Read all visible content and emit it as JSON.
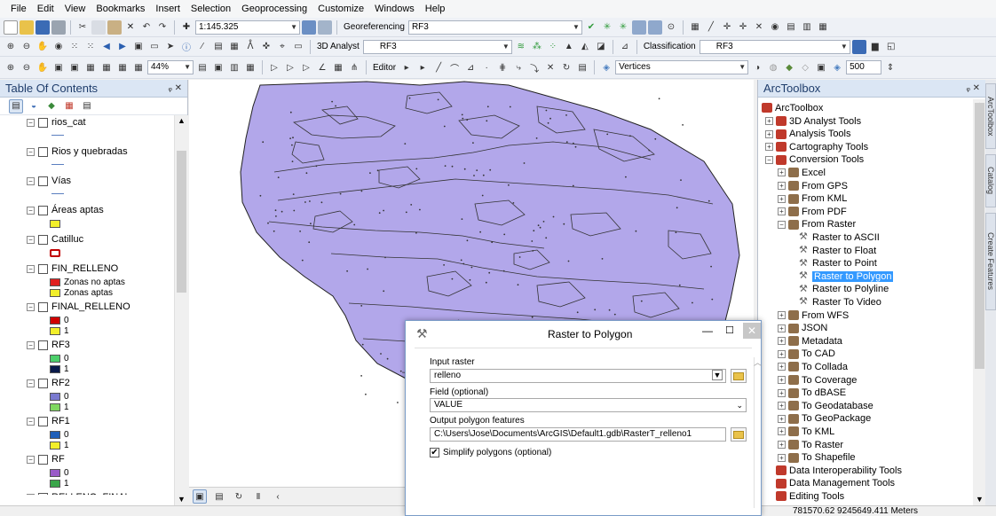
{
  "menu": [
    "File",
    "Edit",
    "View",
    "Bookmarks",
    "Insert",
    "Selection",
    "Geoprocessing",
    "Customize",
    "Windows",
    "Help"
  ],
  "toolbar": {
    "scale": "1:145.325",
    "georef_label": "Georeferencing",
    "georef_layer": "RF3",
    "analyst_label": "3D Analyst",
    "analyst_layer": "RF3",
    "classification_label": "Classification",
    "classification_layer": "RF3",
    "zoom_pct": "44%",
    "editor_label": "Editor",
    "vertices_label": "Vertices",
    "vertex_size": "500"
  },
  "toc": {
    "title": "Table Of Contents",
    "layers": [
      {
        "name": "rios_cat",
        "symbol": "line"
      },
      {
        "name": "Rios y quebradas",
        "symbol": "line"
      },
      {
        "name": "Vías",
        "symbol": "line"
      },
      {
        "name": "Áreas aptas",
        "symbol": "fill",
        "color": "#f2ef2a"
      },
      {
        "name": "Catilluc",
        "symbol": "outline",
        "color": "#c00000"
      },
      {
        "name": "FIN_RELLENO",
        "classes": [
          {
            "label": "Zonas no aptas",
            "color": "#e02020"
          },
          {
            "label": "Zonas aptas",
            "color": "#f2ef2a"
          }
        ]
      },
      {
        "name": "FINAL_RELLENO",
        "classes": [
          {
            "label": "0",
            "color": "#d00000"
          },
          {
            "label": "1",
            "color": "#f2ef2a"
          }
        ]
      },
      {
        "name": "RF3",
        "classes": [
          {
            "label": "0",
            "color": "#4ccf6a"
          },
          {
            "label": "1",
            "color": "#0a1a4a"
          }
        ]
      },
      {
        "name": "RF2",
        "classes": [
          {
            "label": "0",
            "color": "#7a7ad0"
          },
          {
            "label": "1",
            "color": "#7fd860"
          }
        ]
      },
      {
        "name": "RF1",
        "classes": [
          {
            "label": "0",
            "color": "#1f5fb8"
          },
          {
            "label": "1",
            "color": "#f2ef2a"
          }
        ]
      },
      {
        "name": "RF",
        "classes": [
          {
            "label": "0",
            "color": "#9a5ac8"
          },
          {
            "label": "1",
            "color": "#3aa64a"
          }
        ]
      },
      {
        "name": "RELLENO_FINAL",
        "classes": []
      }
    ]
  },
  "map": {
    "fill_color": "#b2a7ea"
  },
  "toolbox": {
    "title": "ArcToolbox",
    "root": "ArcToolbox",
    "items": [
      {
        "label": "3D Analyst Tools",
        "level": 1,
        "kind": "toolbox",
        "exp": "+"
      },
      {
        "label": "Analysis Tools",
        "level": 1,
        "kind": "toolbox",
        "exp": "+"
      },
      {
        "label": "Cartography Tools",
        "level": 1,
        "kind": "toolbox",
        "exp": "+"
      },
      {
        "label": "Conversion Tools",
        "level": 1,
        "kind": "toolbox",
        "exp": "-"
      },
      {
        "label": "Excel",
        "level": 2,
        "kind": "toolset",
        "exp": "+"
      },
      {
        "label": "From GPS",
        "level": 2,
        "kind": "toolset",
        "exp": "+"
      },
      {
        "label": "From KML",
        "level": 2,
        "kind": "toolset",
        "exp": "+"
      },
      {
        "label": "From PDF",
        "level": 2,
        "kind": "toolset",
        "exp": "+"
      },
      {
        "label": "From Raster",
        "level": 2,
        "kind": "toolset",
        "exp": "-"
      },
      {
        "label": "Raster to ASCII",
        "level": 3,
        "kind": "tool"
      },
      {
        "label": "Raster to Float",
        "level": 3,
        "kind": "tool"
      },
      {
        "label": "Raster to Point",
        "level": 3,
        "kind": "tool"
      },
      {
        "label": "Raster to Polygon",
        "level": 3,
        "kind": "tool",
        "selected": true
      },
      {
        "label": "Raster to Polyline",
        "level": 3,
        "kind": "tool"
      },
      {
        "label": "Raster To Video",
        "level": 3,
        "kind": "tool"
      },
      {
        "label": "From WFS",
        "level": 2,
        "kind": "toolset",
        "exp": "+"
      },
      {
        "label": "JSON",
        "level": 2,
        "kind": "toolset",
        "exp": "+"
      },
      {
        "label": "Metadata",
        "level": 2,
        "kind": "toolset",
        "exp": "+"
      },
      {
        "label": "To CAD",
        "level": 2,
        "kind": "toolset",
        "exp": "+"
      },
      {
        "label": "To Collada",
        "level": 2,
        "kind": "toolset",
        "exp": "+"
      },
      {
        "label": "To Coverage",
        "level": 2,
        "kind": "toolset",
        "exp": "+"
      },
      {
        "label": "To dBASE",
        "level": 2,
        "kind": "toolset",
        "exp": "+"
      },
      {
        "label": "To Geodatabase",
        "level": 2,
        "kind": "toolset",
        "exp": "+"
      },
      {
        "label": "To GeoPackage",
        "level": 2,
        "kind": "toolset",
        "exp": "+"
      },
      {
        "label": "To KML",
        "level": 2,
        "kind": "toolset",
        "exp": "+"
      },
      {
        "label": "To Raster",
        "level": 2,
        "kind": "toolset",
        "exp": "+"
      },
      {
        "label": "To Shapefile",
        "level": 2,
        "kind": "toolset",
        "exp": "+"
      },
      {
        "label": "Data Interoperability Tools",
        "level": 1,
        "kind": "toolbox"
      },
      {
        "label": "Data Management Tools",
        "level": 1,
        "kind": "toolbox"
      },
      {
        "label": "Editing Tools",
        "level": 1,
        "kind": "toolbox"
      }
    ],
    "side_tabs": [
      "ArcToolbox",
      "Catalog",
      "Create Features"
    ]
  },
  "dialog": {
    "title": "Raster to Polygon",
    "input_raster_label": "Input raster",
    "input_raster_value": "relleno",
    "field_label": "Field (optional)",
    "field_value": "VALUE",
    "output_label": "Output polygon features",
    "output_value": "C:\\Users\\Jose\\Documents\\ArcGIS\\Default1.gdb\\RasterT_relleno1",
    "simplify_label": "Simplify polygons (optional)",
    "simplify_checked": true
  },
  "status": {
    "coords": "781570.62 9245649.411 Meters"
  }
}
